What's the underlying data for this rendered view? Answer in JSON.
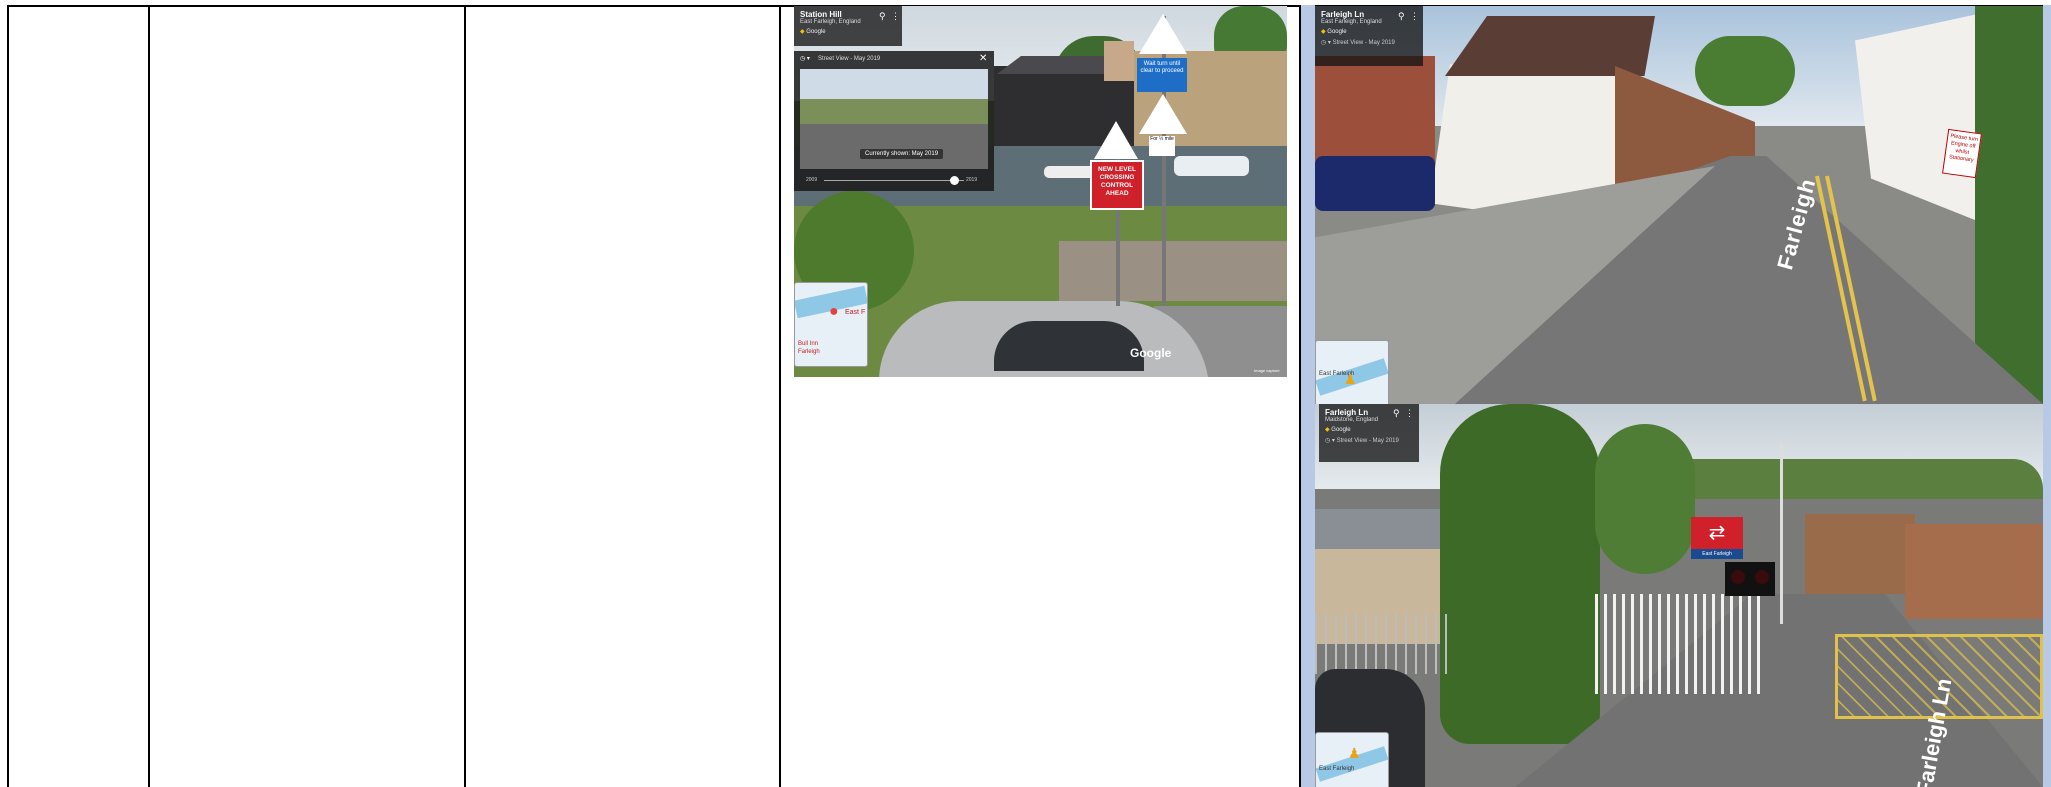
{
  "screenshots": {
    "station_hill": {
      "title": "Station Hill",
      "subtitle": "East Farleigh, England",
      "source": "Google",
      "street_view_label": "Street View - May 2019",
      "tooltip": "Currently shown: May 2019",
      "timeline_start": "2009",
      "timeline_end": "2019",
      "watermark": "Google",
      "copyright": "Image capture",
      "signs": {
        "wait_turn": "Wait turn until clear to proceed",
        "crossing": "NEW LEVEL CROSSING CONTROL AHEAD",
        "distance": "For ½ mile"
      },
      "map_labels": [
        "East F",
        "Bull Inn",
        "Farleigh"
      ]
    },
    "farleigh_ln_top": {
      "title": "Farleigh Ln",
      "subtitle": "East Farleigh, England",
      "source": "Google",
      "street_view_label": "Street View - May 2019",
      "road_marking": "Farleigh",
      "sign_text": "Please turn Engine off whilst Stationary",
      "map_label": "East Farleigh"
    },
    "farleigh_ln_bottom": {
      "title": "Farleigh Ln",
      "subtitle": "Maidstone, England",
      "source": "Google",
      "street_view_label": "Street View - May 2019",
      "station_sign": "East Farleigh",
      "road_marking": "Farleigh Ln",
      "map_label": "East Farleigh"
    }
  }
}
